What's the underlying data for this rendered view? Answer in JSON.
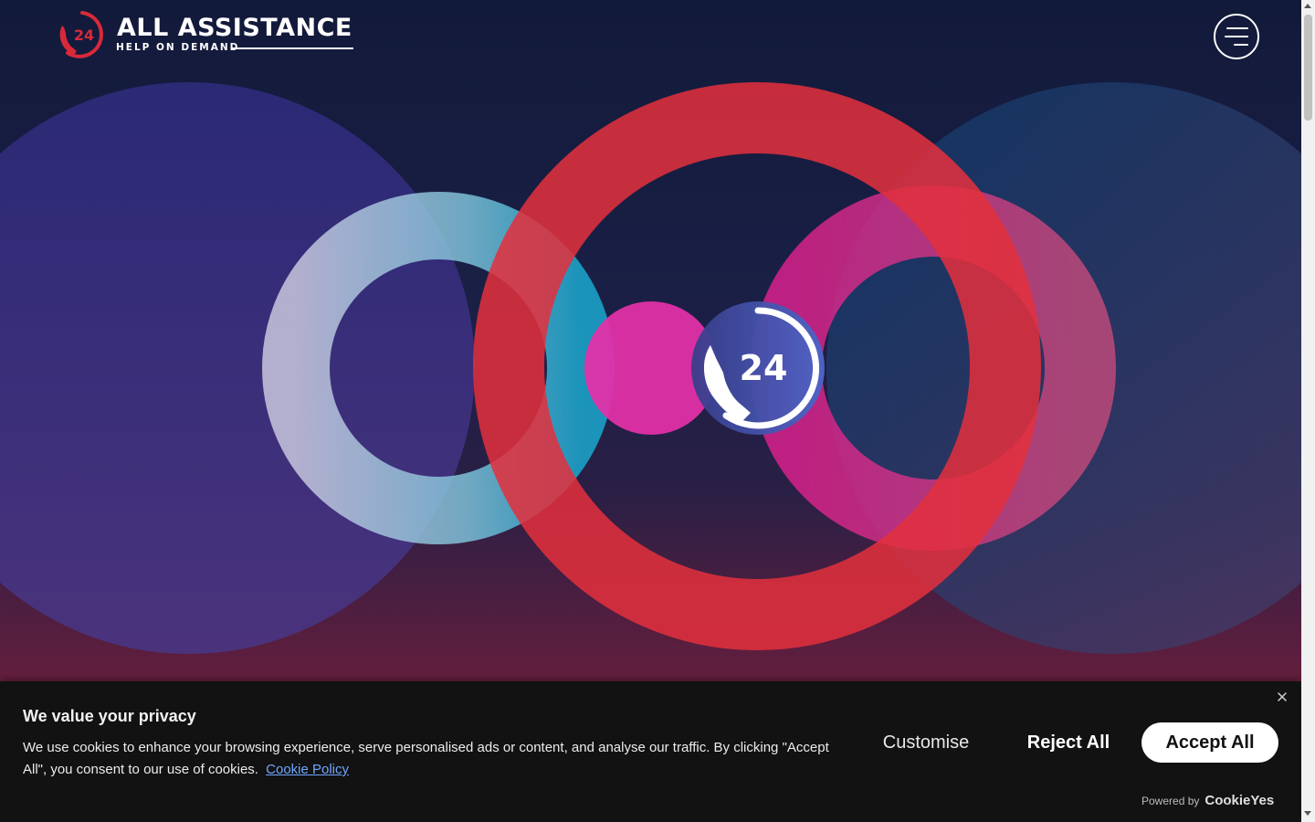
{
  "header": {
    "brand_name": "ALL ASSISTANCE",
    "brand_tagline": "HELP ON DEMAND",
    "logo_badge": "24",
    "menu_icon": "hamburger-menu-icon"
  },
  "hero": {
    "center_badge": "24",
    "center_icon": "phone-24-icon"
  },
  "cookie_banner": {
    "title": "We value your privacy",
    "body": "We use cookies to enhance your browsing experience, serve personalised ads or content, and analyse our traffic. By clicking \"Accept All\", you consent to our use of cookies.",
    "policy_link": "Cookie Policy",
    "customise_label": "Customise",
    "reject_label": "Reject All",
    "accept_label": "Accept All",
    "powered_by": "Powered by",
    "powered_brand": "CookieYes",
    "close_icon": "close-icon"
  },
  "colors": {
    "brand_red": "#d8293a",
    "magenta": "#e02a9e",
    "teal": "#1fa0c0",
    "banner_bg": "#121212",
    "link": "#6fa6ff"
  }
}
